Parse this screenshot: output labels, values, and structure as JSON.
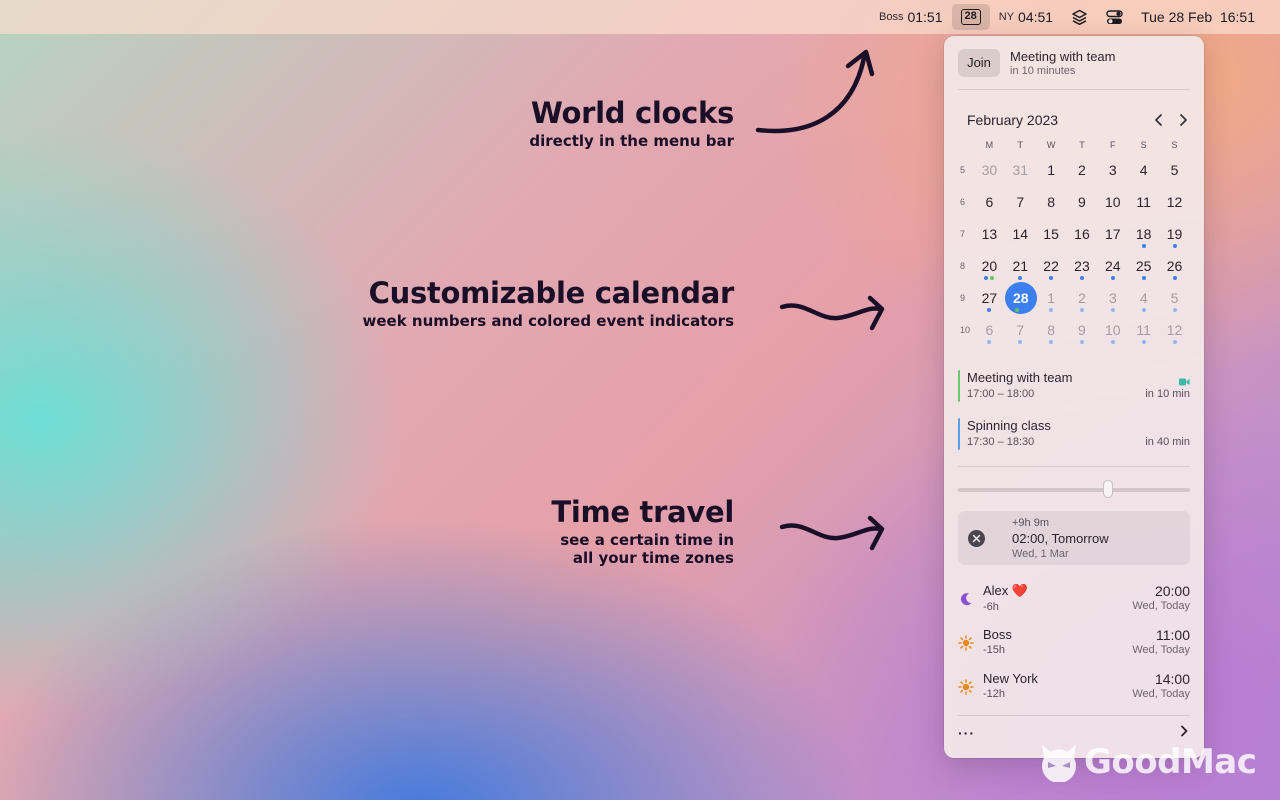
{
  "menubar": {
    "clock1_label": "Boss",
    "clock1_time": "01:51",
    "calendar_day": "28",
    "clock2_label": "NY",
    "clock2_time": "04:51",
    "datetime": "Tue 28 Feb  16:51"
  },
  "annotations": [
    {
      "heading": "World clocks",
      "sub": [
        "directly in the menu bar"
      ]
    },
    {
      "heading": "Customizable calendar",
      "sub": [
        "week numbers and colored event indicators"
      ]
    },
    {
      "heading": "Time travel",
      "sub": [
        "see a certain time in",
        "all your time zones"
      ]
    }
  ],
  "next_meeting": {
    "join_label": "Join",
    "title": "Meeting with team",
    "subtitle": "in 10 minutes"
  },
  "calendar": {
    "month": "February 2023",
    "weekdays": [
      "M",
      "T",
      "W",
      "T",
      "F",
      "S",
      "S"
    ],
    "weeks": [
      {
        "number": "5",
        "days": [
          {
            "d": "30",
            "muted": true
          },
          {
            "d": "31",
            "muted": true
          },
          {
            "d": "1"
          },
          {
            "d": "2"
          },
          {
            "d": "3"
          },
          {
            "d": "4"
          },
          {
            "d": "5"
          }
        ]
      },
      {
        "number": "6",
        "days": [
          {
            "d": "6"
          },
          {
            "d": "7"
          },
          {
            "d": "8"
          },
          {
            "d": "9"
          },
          {
            "d": "10"
          },
          {
            "d": "11"
          },
          {
            "d": "12"
          }
        ]
      },
      {
        "number": "7",
        "days": [
          {
            "d": "13"
          },
          {
            "d": "14"
          },
          {
            "d": "15"
          },
          {
            "d": "16"
          },
          {
            "d": "17"
          },
          {
            "d": "18",
            "dots": [
              "#3b7ff0"
            ]
          },
          {
            "d": "19",
            "dots": [
              "#3b7ff0"
            ]
          }
        ]
      },
      {
        "number": "8",
        "days": [
          {
            "d": "20",
            "dots": [
              "#3b7ff0",
              "#5cc85c"
            ]
          },
          {
            "d": "21",
            "dots": [
              "#3b7ff0"
            ]
          },
          {
            "d": "22",
            "dots": [
              "#3b7ff0"
            ]
          },
          {
            "d": "23",
            "dots": [
              "#3b7ff0"
            ]
          },
          {
            "d": "24",
            "dots": [
              "#3b7ff0"
            ]
          },
          {
            "d": "25",
            "dots": [
              "#3b7ff0"
            ]
          },
          {
            "d": "26",
            "dots": [
              "#3b7ff0"
            ]
          }
        ]
      },
      {
        "number": "9",
        "days": [
          {
            "d": "27",
            "dots": [
              "#3b7ff0"
            ]
          },
          {
            "d": "28",
            "today": true,
            "dots": [
              "#5cc85c",
              "#3b7ff0"
            ]
          },
          {
            "d": "1",
            "muted": true,
            "dots": [
              "#8fb8f4"
            ]
          },
          {
            "d": "2",
            "muted": true,
            "dots": [
              "#8fb8f4"
            ]
          },
          {
            "d": "3",
            "muted": true,
            "dots": [
              "#8fb8f4"
            ]
          },
          {
            "d": "4",
            "muted": true,
            "dots": [
              "#8fb8f4"
            ]
          },
          {
            "d": "5",
            "muted": true,
            "dots": [
              "#8fb8f4"
            ]
          }
        ]
      },
      {
        "number": "10",
        "days": [
          {
            "d": "6",
            "muted": true,
            "dots": [
              "#8fb8f4"
            ]
          },
          {
            "d": "7",
            "muted": true,
            "dots": [
              "#8fb8f4"
            ]
          },
          {
            "d": "8",
            "muted": true,
            "dots": [
              "#8fb8f4"
            ]
          },
          {
            "d": "9",
            "muted": true,
            "dots": [
              "#8fb8f4"
            ]
          },
          {
            "d": "10",
            "muted": true,
            "dots": [
              "#8fb8f4"
            ]
          },
          {
            "d": "11",
            "muted": true,
            "dots": [
              "#8fb8f4"
            ]
          },
          {
            "d": "12",
            "muted": true,
            "dots": [
              "#8fb8f4"
            ]
          }
        ]
      }
    ]
  },
  "events": [
    {
      "title": "Meeting with team",
      "time": "17:00 – 18:00",
      "relative": "in 10 min",
      "color": "#6cc870",
      "video": true
    },
    {
      "title": "Spinning class",
      "time": "17:30 – 18:30",
      "relative": "in 40 min",
      "color": "#5aa0e8",
      "video": false
    }
  ],
  "time_travel": {
    "slider_fraction": 0.6,
    "offset": "+9h 9m",
    "time": "02:00, Tomorrow",
    "date": "Wed, 1 Mar"
  },
  "zones": [
    {
      "name": "Alex ❤️",
      "offset": "-6h",
      "time": "20:00",
      "day": "Wed, Today",
      "icon": "moon-icon"
    },
    {
      "name": "Boss",
      "offset": "-15h",
      "time": "11:00",
      "day": "Wed, Today",
      "icon": "sun-icon"
    },
    {
      "name": "New York",
      "offset": "-12h",
      "time": "14:00",
      "day": "Wed, Today",
      "icon": "sun-icon"
    }
  ],
  "footer": {
    "more_label": "···"
  },
  "watermark": {
    "text": "GoodMac"
  },
  "colors": {
    "accent": "#3b7ff0",
    "green": "#5cc85c",
    "moon": "#8a4fd0",
    "sun": "#e8891c"
  }
}
